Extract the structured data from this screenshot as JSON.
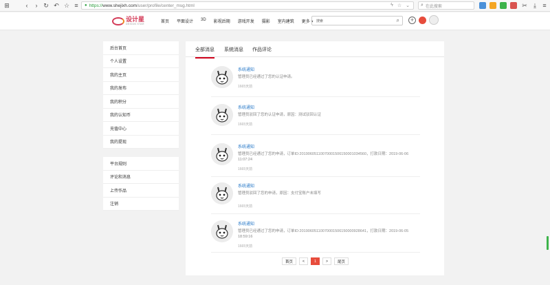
{
  "browser": {
    "url_protocol": "https://",
    "url_domain": "www.shejixh.com",
    "url_path": "/user/profile/center_msg.html",
    "search_placeholder": "在此搜索"
  },
  "site": {
    "logo_cn": "设计星",
    "logo_en": "DESIGN STAR",
    "nav": [
      "首页",
      "平面设计",
      "3D",
      "影视后期",
      "游戏开发",
      "摄影",
      "室内建筑",
      "更多 ▾"
    ],
    "search_value": "搜索"
  },
  "sidebar": {
    "group1": [
      "后台首页",
      "个人设置",
      "我的主页",
      "我的发布",
      "我的积分",
      "我的认知币",
      "充值中心",
      "我的提现"
    ],
    "group2": [
      "平台规则",
      "评论和消息",
      "上传作品",
      "注销"
    ]
  },
  "tabs": [
    "全部消息",
    "系统消息",
    "作品评论"
  ],
  "messages": [
    {
      "title": "系统通知",
      "body": "管理员已经通过了您的认证申请。",
      "time": "1665天前"
    },
    {
      "title": "系统通知",
      "body": "管理员驳回了您的认证申请，原因：测试驳回认证",
      "time": "1665天前"
    },
    {
      "title": "系统通知",
      "body": "管理员已经通过了您的申请，订单ID:2019060511007000150615000103456​0，打款日期：2019-06-06 11:07:24",
      "time": "1665天前"
    },
    {
      "title": "系统通知",
      "body": "管理员驳回了您的申请，原因：支付宝账户未填写",
      "time": "1665天前"
    },
    {
      "title": "系统通知",
      "body": "管理员已经通过了您的申请，订单ID:20190605110070001506150000928641，打款日期：2019-06-05 18:59:16",
      "time": "1665天前"
    }
  ],
  "pagination": {
    "first": "首页",
    "prev": "<",
    "current": "1",
    "next": ">",
    "last": "尾页"
  },
  "colors": {
    "accent": "#d0021b",
    "link": "#2b7bc9",
    "page_active": "#e74c3c"
  }
}
